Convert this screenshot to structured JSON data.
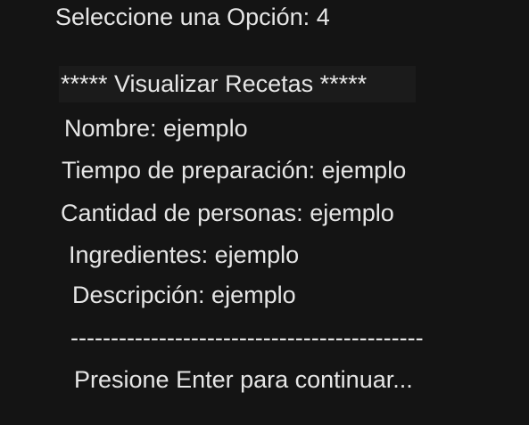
{
  "console": {
    "prompt_line": "Seleccione una Opción: 4",
    "section_header": "***** Visualizar Recetas *****",
    "fields": [
      "Nombre: ejemplo",
      "Tiempo de preparación: ejemplo",
      "Cantidad de personas: ejemplo",
      "Ingredientes: ejemplo",
      "Descripción: ejemplo"
    ],
    "separator": "--------------------------------------------",
    "continue_prompt": "Presione Enter para continuar..."
  },
  "colors": {
    "background": "#141414",
    "text": "#e6e6e6"
  }
}
